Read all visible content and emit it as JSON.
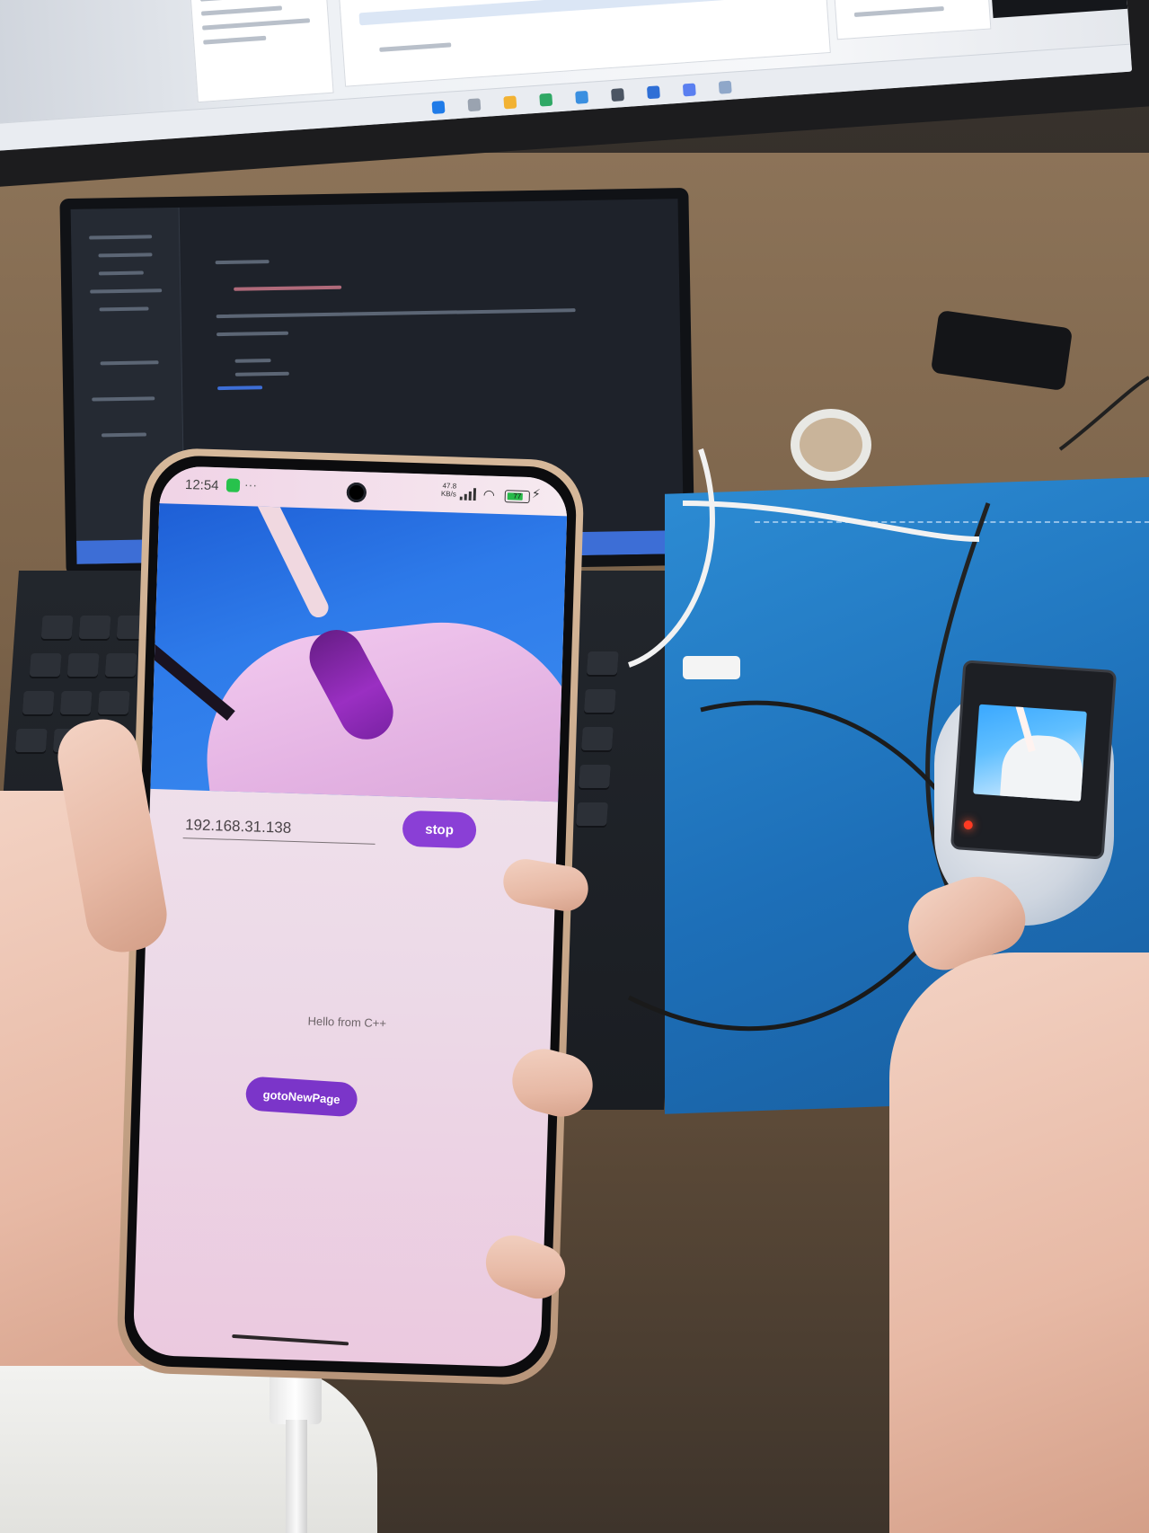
{
  "phone": {
    "status_bar": {
      "time": "12:54",
      "more": "···",
      "net_speed_value": "47.8",
      "net_speed_unit": "KB/s",
      "battery_level": "77",
      "battery_fraction": 0.77
    },
    "app": {
      "ip_input_value": "192.168.31.138",
      "stop_button_label": "stop",
      "hello_text": "Hello from C++",
      "goto_button_label": "gotoNewPage"
    }
  },
  "colors": {
    "button_purple": "#8a3fd6",
    "app_background": "#ecd9e7",
    "camera_background_blue": "#2e7bea"
  },
  "icons": [
    "wechat-icon",
    "signal-icon",
    "wifi-icon",
    "battery-icon",
    "charging-icon"
  ]
}
